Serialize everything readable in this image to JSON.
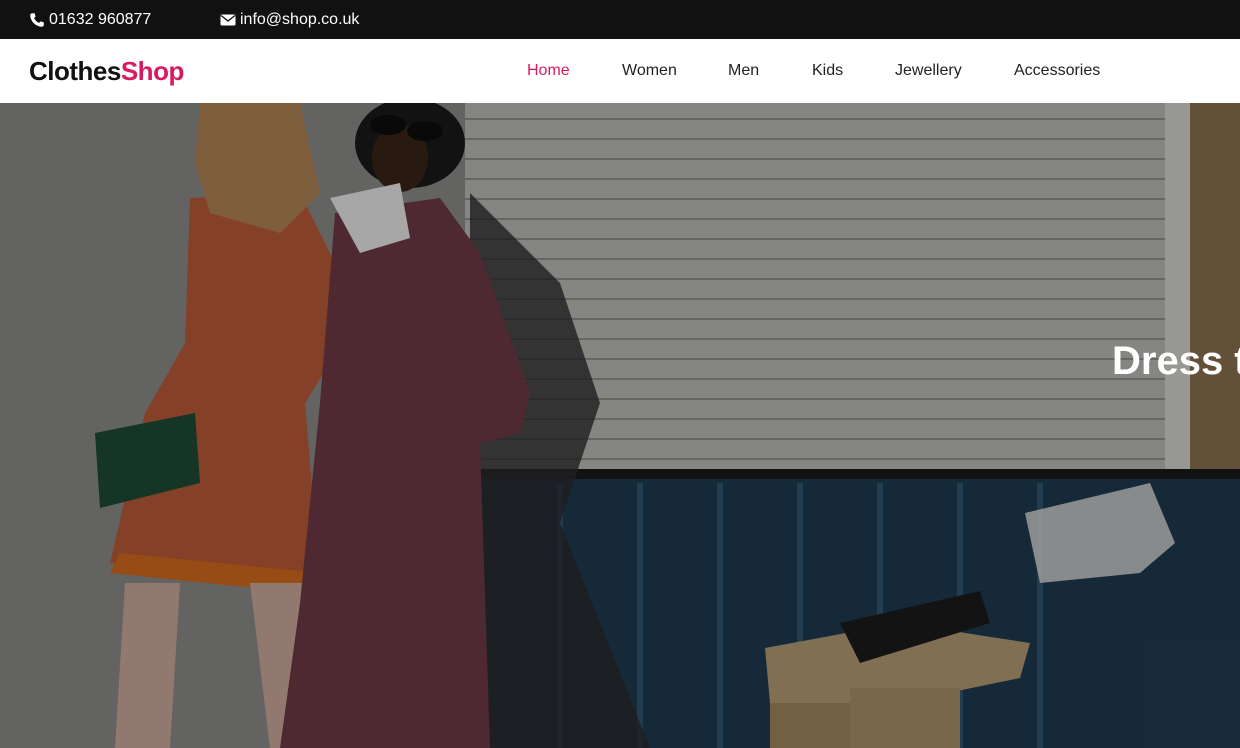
{
  "topbar": {
    "phone": "01632 960877",
    "phone_icon": "phone-icon",
    "email": "info@shop.co.uk",
    "email_icon": "envelope-icon"
  },
  "brand": {
    "part1": "Clothes",
    "part2": "Shop",
    "accent_color": "#d81b60"
  },
  "nav": {
    "items": [
      {
        "label": "Home",
        "active": true
      },
      {
        "label": "Women",
        "active": false
      },
      {
        "label": "Men",
        "active": false
      },
      {
        "label": "Kids",
        "active": false
      },
      {
        "label": "Jewellery",
        "active": false
      },
      {
        "label": "Accessories",
        "active": false
      }
    ]
  },
  "hero": {
    "title": "Dress t"
  }
}
